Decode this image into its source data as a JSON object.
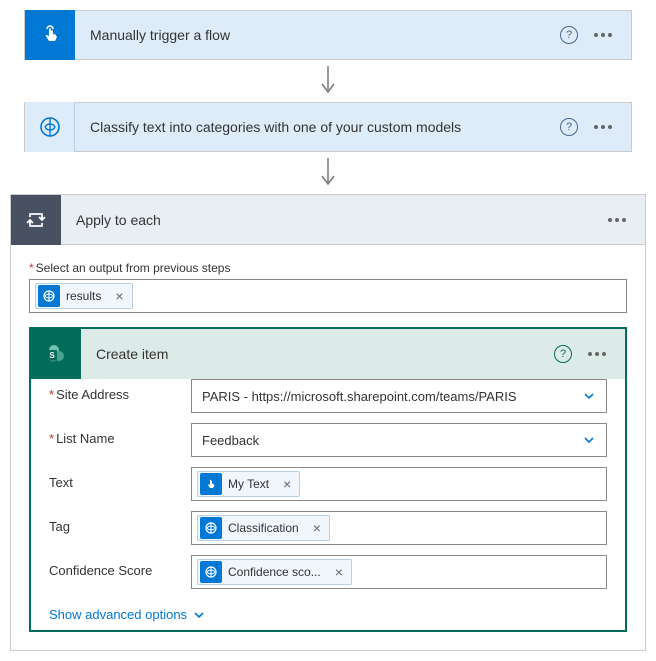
{
  "steps": {
    "trigger": {
      "title": "Manually trigger a flow"
    },
    "classify": {
      "title": "Classify text into categories with one of your custom models"
    },
    "apply": {
      "title": "Apply to each"
    },
    "create": {
      "title": "Create item"
    }
  },
  "apply": {
    "prev_steps_label": "Select an output from previous steps",
    "token": "results"
  },
  "create_item": {
    "fields": {
      "site_address": {
        "label": "Site Address",
        "value": "PARIS - https://microsoft.sharepoint.com/teams/PARIS"
      },
      "list_name": {
        "label": "List Name",
        "value": "Feedback"
      },
      "text": {
        "label": "Text",
        "token": "My Text"
      },
      "tag": {
        "label": "Tag",
        "token": "Classification"
      },
      "confidence": {
        "label": "Confidence Score",
        "token": "Confidence sco..."
      }
    },
    "show_advanced": "Show advanced options"
  }
}
